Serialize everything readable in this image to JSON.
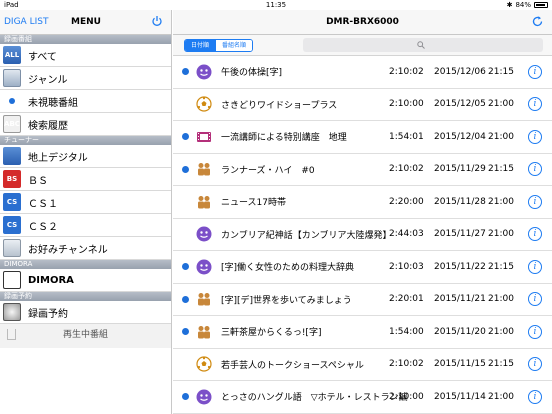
{
  "statusbar": {
    "device": "iPad",
    "time": "11:35",
    "battery": "84%"
  },
  "sidebar": {
    "brand": "DIGA LIST",
    "menu_title": "MENU",
    "sections": {
      "recorded": "録画番組",
      "tuner": "チューナー",
      "dimora": "DIMORA",
      "reservation": "録画予約"
    },
    "items": {
      "all": "すべて",
      "genre": "ジャンル",
      "unwatched": "未視聴番組",
      "search_history": "検索履歴",
      "terrestrial": "地上デジタル",
      "bs": "ＢＳ",
      "cs1": "ＣＳ１",
      "cs2": "ＣＳ２",
      "favorites": "お好みチャンネル",
      "dimora": "DIMORA",
      "reservation": "録画予約"
    },
    "icons": {
      "bs": "BS",
      "cs": "CS",
      "all": "ALL",
      "abc": "ABC",
      "dimora": "D"
    },
    "now_playing": "再生中番組"
  },
  "main": {
    "title": "DMR-BRX6000",
    "sort": {
      "by_date": "日付順",
      "by_name": "番組名順"
    },
    "search": {
      "placeholder": ""
    },
    "rows": [
      {
        "title": "午後の体操[字]",
        "duration": "2:10:02",
        "date": "2015/12/06",
        "time": "21:15",
        "unseen": true,
        "genre": "face"
      },
      {
        "title": "さきどりワイドショープラス",
        "duration": "2:10:00",
        "date": "2015/12/05",
        "time": "21:00",
        "unseen": false,
        "genre": "soccer"
      },
      {
        "title": "一流講師による特別講座　地理",
        "duration": "1:54:01",
        "date": "2015/12/04",
        "time": "21:00",
        "unseen": true,
        "genre": "film"
      },
      {
        "title": "ランナーズ・ハイ　#0",
        "duration": "2:10:02",
        "date": "2015/11/29",
        "time": "21:15",
        "unseen": true,
        "genre": "people"
      },
      {
        "title": "ニュース17時帯",
        "duration": "2:20:00",
        "date": "2015/11/28",
        "time": "21:00",
        "unseen": false,
        "genre": "people"
      },
      {
        "title": "カンブリア紀神話【カンブリア大陸爆発】",
        "duration": "2:44:03",
        "date": "2015/11/27",
        "time": "21:00",
        "unseen": false,
        "genre": "face"
      },
      {
        "title": "[字]働く女性のための料理大辞典",
        "duration": "2:10:03",
        "date": "2015/11/22",
        "time": "21:15",
        "unseen": true,
        "genre": "face"
      },
      {
        "title": "[字][デ]世界を歩いてみましょう",
        "duration": "2:20:01",
        "date": "2015/11/21",
        "time": "21:00",
        "unseen": true,
        "genre": "people"
      },
      {
        "title": "三軒茶屋からくるっ![字]",
        "duration": "1:54:00",
        "date": "2015/11/20",
        "time": "21:00",
        "unseen": true,
        "genre": "people"
      },
      {
        "title": "若手芸人のトークショースペシャル",
        "duration": "2:10:02",
        "date": "2015/11/15",
        "time": "21:15",
        "unseen": false,
        "genre": "soccer"
      },
      {
        "title": "とっさのハングル語　▽ホテル・レストラン編",
        "duration": "2:10:00",
        "date": "2015/11/14",
        "time": "21:00",
        "unseen": true,
        "genre": "face"
      }
    ]
  },
  "colors": {
    "accent": "#1e7cf2",
    "unseen_dot": "#1e6fd9",
    "section_bar": "#a9b1bc"
  }
}
